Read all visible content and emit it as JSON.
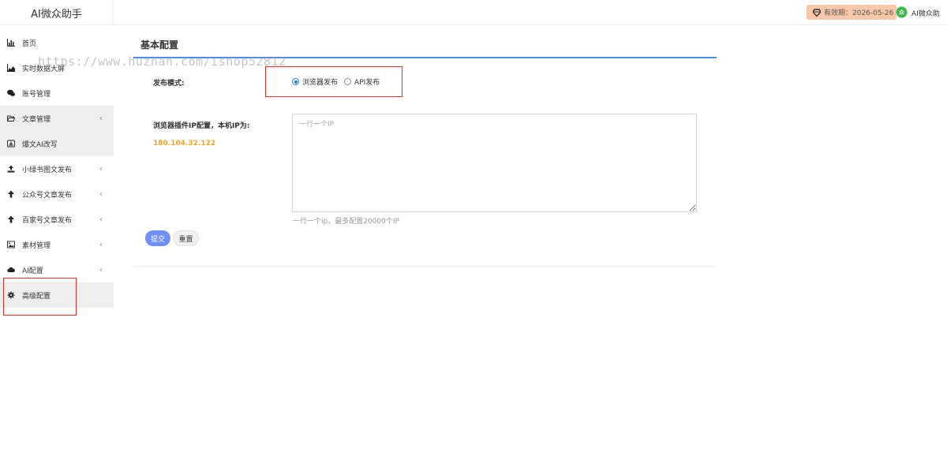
{
  "header": {
    "logo": "AI微众助手",
    "expiry_label": "有效期：2026-05-26",
    "user_name": "AI微众助",
    "avatar_text": "众"
  },
  "sidebar": {
    "items": [
      {
        "label": "首页",
        "icon": "bar-chart-icon",
        "has_chevron": false
      },
      {
        "label": "实时数据大屏",
        "icon": "area-chart-icon",
        "has_chevron": false
      },
      {
        "label": "账号管理",
        "icon": "wechat-icon",
        "has_chevron": false
      },
      {
        "label": "文章管理",
        "icon": "folder-open-icon",
        "has_chevron": true
      },
      {
        "label": "爆文AI改写",
        "icon": "inbox-icon",
        "has_chevron": false
      },
      {
        "label": "小绿书图文发布",
        "icon": "upload-icon",
        "has_chevron": true
      },
      {
        "label": "公众号文章发布",
        "icon": "arrow-up-icon",
        "has_chevron": true
      },
      {
        "label": "百家号文章发布",
        "icon": "arrow-up-icon",
        "has_chevron": true
      },
      {
        "label": "素材管理",
        "icon": "image-icon",
        "has_chevron": true
      },
      {
        "label": "AI配置",
        "icon": "cloud-icon",
        "has_chevron": true
      },
      {
        "label": "高级配置",
        "icon": "gear-icon",
        "has_chevron": false
      }
    ],
    "chevron": "‹"
  },
  "watermark": "https://www.huzhan.com/ishop52812",
  "main": {
    "title": "基本配置",
    "publish_mode_label": "发布模式:",
    "radio_options": [
      {
        "label": "浏览器发布",
        "selected": true
      },
      {
        "label": "API发布",
        "selected": false
      }
    ],
    "ip_config_label": "浏览器插件IP配置，本机IP为:",
    "local_ip": "180.104.32.122",
    "textarea_placeholder": "一行一个IP",
    "hint": "一行一个ip，最多配置20000个IP",
    "submit_label": "提交",
    "reset_label": "重置"
  },
  "colors": {
    "accent": "#4b8df8",
    "ip_orange": "#f5a524",
    "highlight_red": "#e0302a",
    "submit_blue": "#6e8ff5",
    "expiry_bg": "#f8c8a9"
  }
}
